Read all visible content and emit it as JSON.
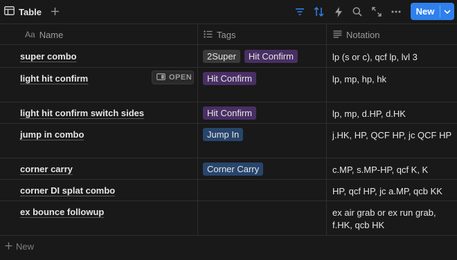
{
  "toolbar": {
    "view_label": "Table",
    "add_view_icon": "plus-icon",
    "icons": [
      "filter-icon",
      "sort-icon",
      "automation-icon",
      "search-icon",
      "expand-icon",
      "more-icon"
    ],
    "new_label": "New",
    "accent_color": "#2f80ed"
  },
  "columns": {
    "name": "Name",
    "tags": "Tags",
    "notation": "Notation"
  },
  "open_label": "OPEN",
  "rows": [
    {
      "name": "super combo",
      "tags": [
        {
          "label": "2Super",
          "color": "#3a3a3a"
        },
        {
          "label": "Hit Confirm",
          "color": "#492f64"
        }
      ],
      "notation": "lp (s or c), qcf lp, lvl 3"
    },
    {
      "name": "light hit confirm",
      "tags": [
        {
          "label": "Hit Confirm",
          "color": "#492f64"
        }
      ],
      "notation": "lp, mp, hp, hk"
    },
    {
      "name": "light hit confirm switch sides",
      "tags": [
        {
          "label": "Hit Confirm",
          "color": "#492f64"
        }
      ],
      "notation": "lp, mp, d.HP, d.HK"
    },
    {
      "name": "jump in combo",
      "tags": [
        {
          "label": "Jump In",
          "color": "#28456c"
        }
      ],
      "notation": "j.HK, HP, QCF HP, jc QCF HP"
    },
    {
      "name": "corner carry",
      "tags": [
        {
          "label": "Corner Carry",
          "color": "#28456c"
        }
      ],
      "notation": "c.MP, s.MP-HP, qcf K, K"
    },
    {
      "name": "corner DI splat combo",
      "tags": [],
      "notation": "HP, qcf HP, jc a.MP, qcb KK"
    },
    {
      "name": "ex bounce followup",
      "tags": [],
      "notation": "ex air grab or ex run grab, f.HK, qcb HK"
    }
  ],
  "footer": {
    "new_label": "New"
  }
}
